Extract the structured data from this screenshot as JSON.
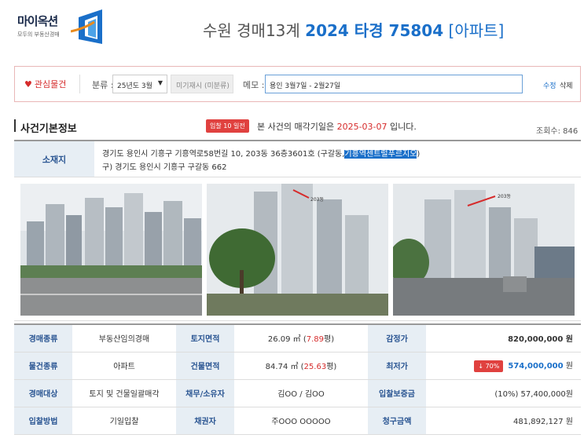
{
  "logo": {
    "name": "마이옥션",
    "slogan": "모두의 부동산경매"
  },
  "header": {
    "court": "수원 경매13계",
    "case_number": "2024 타경 75804",
    "property_type": "[아파트]"
  },
  "toolbar": {
    "favorite_label": "관심물건",
    "category_label": "분류 :",
    "category_value": "25년도 3월",
    "unclassified_label": "미기재시 (미분류)",
    "memo_label": "메모 :",
    "memo_value": "용인 3월7일 - 2월27일",
    "edit_label": "수정",
    "delete_label": "삭제"
  },
  "section": {
    "title": "사건기본정보",
    "badge": "입찰 10 일전",
    "notice_prefix": "본 사건의 매각기일은",
    "sale_date": "2025-03-07",
    "notice_suffix": "입니다.",
    "views": "조회수: 846"
  },
  "location": {
    "label": "소재지",
    "address_prefix": "경기도 용인시 기흥구 기흥역로58번길 10, 203동 36층3601호 (구갈동,",
    "address_highlight": "기흥역센트럴푸르지오",
    "address_suffix": ")",
    "old_address": "구) 경기도 용인시 기흥구 구갈동 662"
  },
  "photos": {
    "label_2": "203동",
    "label_3": "203동"
  },
  "info": {
    "rows": [
      {
        "l1": "경매종류",
        "v1": "부동산임의경매",
        "l2": "토지면적",
        "v2a": "26.09 ㎡ (",
        "v2b": "7.89",
        "v2c": "평)",
        "l3": "감정가",
        "v3": "820,000,000 원"
      },
      {
        "l1": "물건종류",
        "v1": "아파트",
        "l2": "건물면적",
        "v2a": "84.74 ㎡ (",
        "v2b": "25.63",
        "v2c": "평)",
        "l3": "최저가",
        "v3_badge": "↓ 70%",
        "v3": "574,000,000",
        "v3_unit": "원"
      },
      {
        "l1": "경매대상",
        "v1": "토지 및 건물일괄매각",
        "l2": "채무/소유자",
        "v2": "김OO / 김OO",
        "l3": "입찰보증금",
        "v3": "(10%) 57,400,000원"
      },
      {
        "l1": "입찰방법",
        "v1": "기일입찰",
        "l2": "채권자",
        "v2": "주OOO OOOOO",
        "l3": "청구금액",
        "v3": "481,892,127 원"
      }
    ]
  },
  "colors": {
    "accent": "#1a6fc9",
    "alert": "#d62b2b",
    "label_bg": "#e7eef4",
    "label_text": "#2a5592"
  }
}
